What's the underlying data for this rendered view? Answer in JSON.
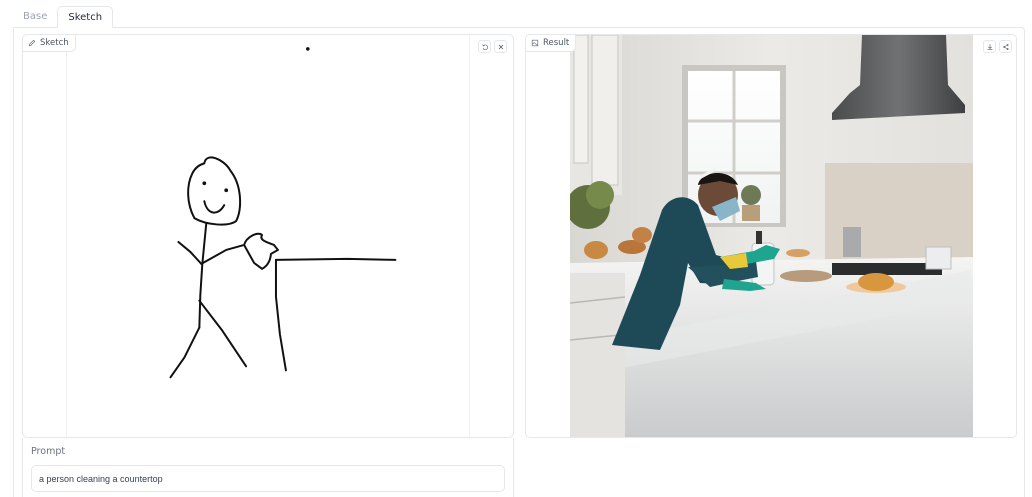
{
  "tabs": [
    {
      "label": "Base",
      "active": false
    },
    {
      "label": "Sketch",
      "active": true
    }
  ],
  "sketch": {
    "label": "Sketch",
    "icon": "pencil-icon",
    "buttons": [
      {
        "name": "undo-button",
        "icon": "undo-icon"
      },
      {
        "name": "clear-button",
        "icon": "close-icon"
      }
    ]
  },
  "result": {
    "label": "Result",
    "icon": "image-icon",
    "buttons": [
      {
        "name": "download-button",
        "icon": "download-icon"
      },
      {
        "name": "share-button",
        "icon": "share-icon"
      }
    ]
  },
  "prompt": {
    "label": "Prompt",
    "value": "a person cleaning a countertop"
  },
  "colors": {
    "border": "#e5e7eb",
    "stroke": "#111111",
    "muted_text": "#9ca3af"
  }
}
